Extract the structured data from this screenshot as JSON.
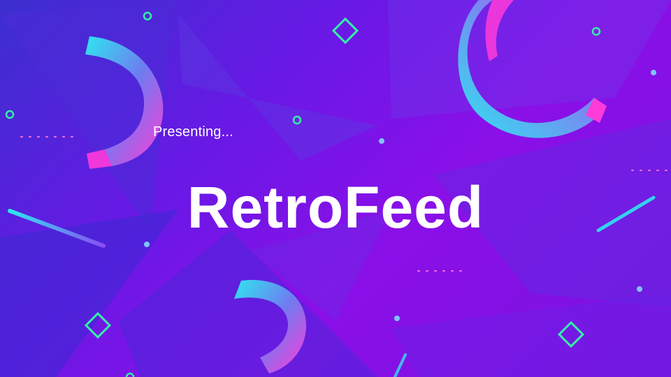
{
  "slide": {
    "subtitle": "Presenting...",
    "title": "RetroFeed"
  },
  "theme": {
    "background": "#6a18e6",
    "accent_cyan": "#2ee6f0",
    "accent_magenta": "#ff3bd9",
    "accent_green": "#34f0a8",
    "text": "#ffffff"
  },
  "decorations": [
    "ring-shape",
    "diamond-outline",
    "circle-outline",
    "dot",
    "dotted-line",
    "stroke-line",
    "triangle-shape"
  ]
}
